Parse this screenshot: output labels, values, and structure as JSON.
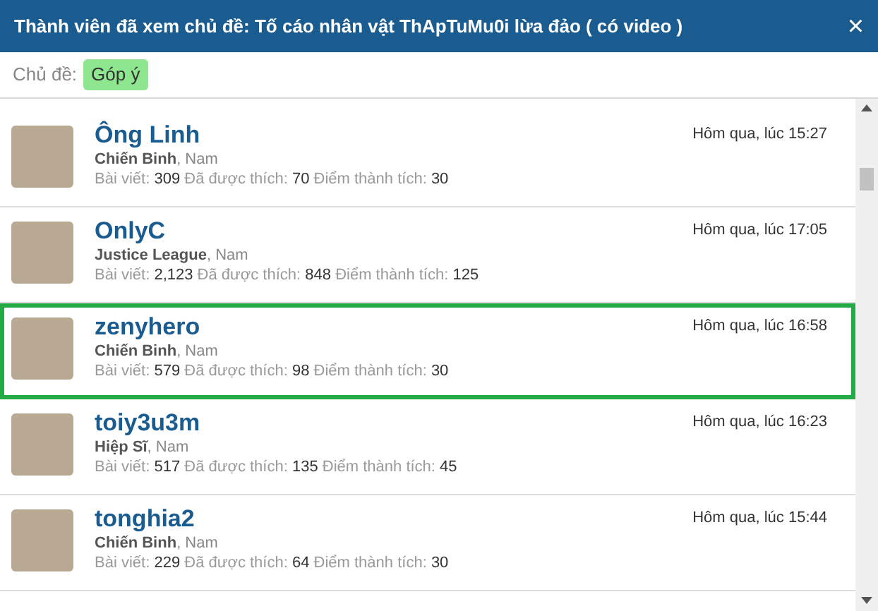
{
  "window": {
    "title": "Thành viên đã xem chủ đề: Tố cáo nhân vật ThApTuMu0i lừa đảo ( có video )",
    "close": "×"
  },
  "topic": {
    "label": "Chủ đề:",
    "tag": "Góp ý"
  },
  "members": [
    {
      "name": "Ông Linh",
      "rank": "Chiến Binh",
      "gender": ", Nam",
      "time": "Hôm qua, lúc 15:27",
      "selected": false,
      "stats": [
        {
          "label": "Bài viết:",
          "value": "309"
        },
        {
          "label": "Đã được thích:",
          "value": "70"
        },
        {
          "label": "Điểm thành tích:",
          "value": "30"
        }
      ]
    },
    {
      "name": "OnlyC",
      "rank": "Justice League",
      "gender": ", Nam",
      "time": "Hôm qua, lúc 17:05",
      "selected": false,
      "stats": [
        {
          "label": "Bài viết:",
          "value": "2,123"
        },
        {
          "label": "Đã được thích:",
          "value": "848"
        },
        {
          "label": "Điểm thành tích:",
          "value": "125"
        }
      ]
    },
    {
      "name": "zenyhero",
      "rank": "Chiến Binh",
      "gender": ", Nam",
      "time": "Hôm qua, lúc 16:58",
      "selected": true,
      "stats": [
        {
          "label": "Bài viết:",
          "value": "579"
        },
        {
          "label": "Đã được thích:",
          "value": "98"
        },
        {
          "label": "Điểm thành tích:",
          "value": "30"
        }
      ]
    },
    {
      "name": "toiy3u3m",
      "rank": "Hiệp Sĩ",
      "gender": ", Nam",
      "time": "Hôm qua, lúc 16:23",
      "selected": false,
      "stats": [
        {
          "label": "Bài viết:",
          "value": "517"
        },
        {
          "label": "Đã được thích:",
          "value": "135"
        },
        {
          "label": "Điểm thành tích:",
          "value": "45"
        }
      ]
    },
    {
      "name": "tonghia2",
      "rank": "Chiến Binh",
      "gender": ", Nam",
      "time": "Hôm qua, lúc 15:44",
      "selected": false,
      "stats": [
        {
          "label": "Bài viết:",
          "value": "229"
        },
        {
          "label": "Đã được thích:",
          "value": "64"
        },
        {
          "label": "Điểm thành tích:",
          "value": "30"
        }
      ]
    }
  ]
}
